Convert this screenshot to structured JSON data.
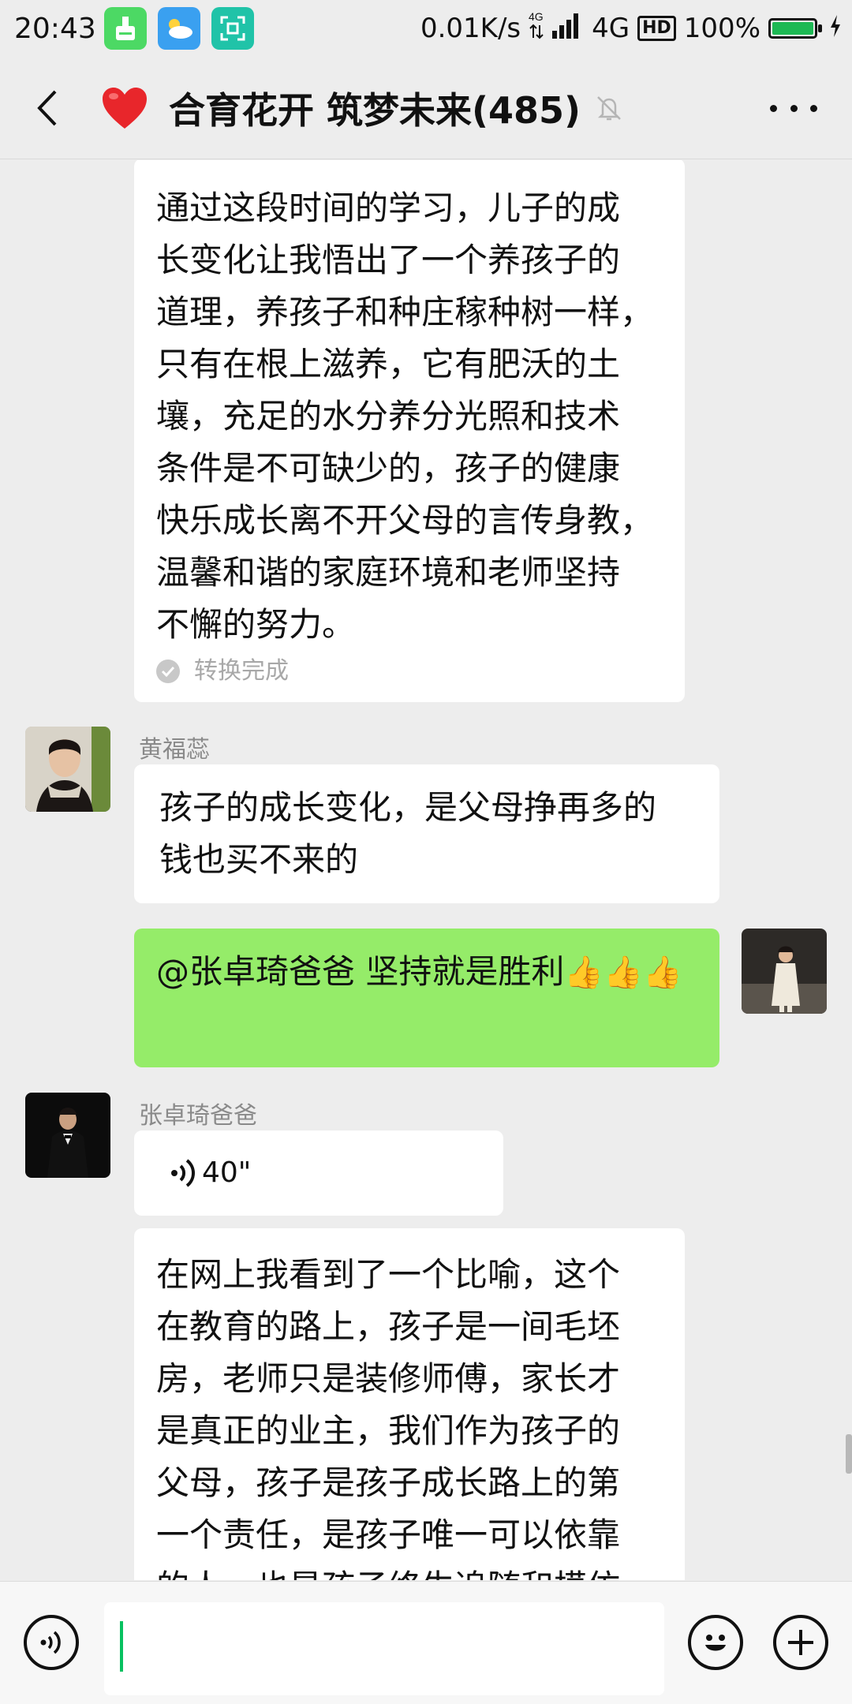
{
  "status_bar": {
    "time": "20:43",
    "net_speed": "0.01K/s",
    "network": "4G",
    "hd": "HD",
    "battery": "100%",
    "battery_level": 1.0
  },
  "header": {
    "title": "合育花开 筑梦未来(485)"
  },
  "messages": {
    "m1": {
      "lines": [
        "通过这段时间的学习，儿子的成",
        "长变化让我悟出了一个养孩子的",
        "道理，养孩子和种庄稼种树一样，",
        "只有在根上滋养，它有肥沃的土",
        "壤，充足的水分养分光照和技术",
        "条件是不可缺少的，孩子的健康",
        "快乐成长离不开父母的言传身教，",
        "温馨和谐的家庭环境和老师坚持",
        "不懈的努力。"
      ],
      "convert_status": "转换完成"
    },
    "m2": {
      "sender": "黄福蕊",
      "lines": [
        "孩子的成长变化，是父母挣再多的",
        "钱也买不来的"
      ]
    },
    "m3": {
      "text": "@张卓琦爸爸  坚持就是胜利",
      "thumb": "👍"
    },
    "m4": {
      "sender": "张卓琦爸爸",
      "voice_duration": "40\""
    },
    "m5": {
      "lines": [
        "在网上我看到了一个比喻，这个",
        "在教育的路上，孩子是一间毛坯",
        "房，老师只是装修师傅，家长才",
        "是真正的业主，我们作为孩子的",
        "父母，孩子是孩子成长路上的第",
        "一个责任，是孩子唯一可以依靠",
        "的人，也是孩子终生追随和模仿"
      ]
    }
  },
  "colors": {
    "background": "#ededed",
    "bubble_incoming": "#ffffff",
    "bubble_outgoing": "#95ec69",
    "caret": "#07c160"
  }
}
